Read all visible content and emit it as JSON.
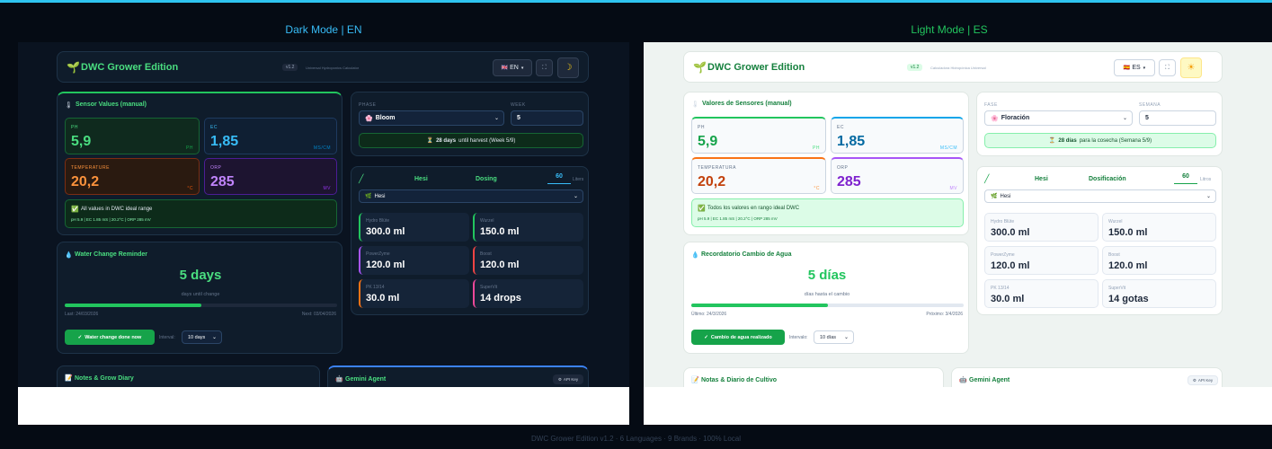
{
  "captions": {
    "dark": "Dark Mode  |  EN",
    "light": "Light Mode  |  ES"
  },
  "footer": "DWC Grower Edition v1.2  ·  6 Languages  ·  9 Brands  ·  100% Local",
  "colors": {
    "accent_green": "#22c55e",
    "accent_blue": "#38bdf8",
    "ph": "#22c55e",
    "ec": "#38bdf8",
    "temperature": "#f97316",
    "orp": "#a855f7"
  },
  "dark": {
    "header": {
      "brand": "DWC Grower Edition",
      "version": "v1.2",
      "tagline": "Universal Hydroponics Calculator",
      "language": "EN",
      "flag": "uk-flag-icon",
      "theme_icon": "moon-icon"
    },
    "sensors": {
      "title": "Sensor Values (manual)",
      "ph": {
        "label": "PH",
        "value": "5,9",
        "unit": "PH"
      },
      "ec": {
        "label": "EC",
        "value": "1,85",
        "unit": "MS/CM"
      },
      "temp": {
        "label": "TEMPERATURE",
        "value": "20,2",
        "unit": "°C"
      },
      "orp": {
        "label": "ORP",
        "value": "285",
        "unit": "MV"
      },
      "status": "All values in DWC ideal range",
      "status_detail": "pH 5.9 | EC 1.85 mS | 20.2°C | ORP 285 mV"
    },
    "phase": {
      "phase_label": "PHASE",
      "phase_value": "Bloom",
      "week_label": "WEEK",
      "week_value": "5",
      "harvest_strong": "28 days",
      "harvest_rest": "until harvest (Week 5/9)"
    },
    "dosing": {
      "brand": "Hesi",
      "title": "Dosing",
      "liters": "60",
      "liters_unit": "Liters",
      "select": "Hesi",
      "items": [
        {
          "name": "Hydro Blüte",
          "amount": "300.0 ml"
        },
        {
          "name": "Wurzel",
          "amount": "150.0 ml"
        },
        {
          "name": "PowerZyme",
          "amount": "120.0 ml"
        },
        {
          "name": "Boost",
          "amount": "120.0 ml"
        },
        {
          "name": "PK 13/14",
          "amount": "30.0 ml"
        },
        {
          "name": "SuperVit",
          "amount": "14 drops"
        }
      ]
    },
    "water": {
      "title": "Water Change Reminder",
      "days": "5 days",
      "caption": "days until change",
      "progress": 0.5,
      "last": "Last: 24/03/2026",
      "next": "Next: 03/04/2026",
      "button": "Water change done now",
      "interval_label": "Interval:",
      "interval_value": "10 days"
    },
    "notes": {
      "title": "Notes & Grow Diary"
    },
    "agent": {
      "title": "Gemini Agent",
      "api": "API Key"
    }
  },
  "light": {
    "header": {
      "brand": "DWC Grower Edition",
      "version": "v1.2",
      "tagline": "Calculadora Hidropónica Universal",
      "language": "ES",
      "flag": "spain-flag-icon",
      "theme_icon": "sun-icon"
    },
    "sensors": {
      "title": "Valores de Sensores (manual)",
      "ph": {
        "label": "PH",
        "value": "5,9",
        "unit": "PH"
      },
      "ec": {
        "label": "EC",
        "value": "1,85",
        "unit": "MS/CM"
      },
      "temp": {
        "label": "TEMPERATURA",
        "value": "20,2",
        "unit": "°C"
      },
      "orp": {
        "label": "ORP",
        "value": "285",
        "unit": "MV"
      },
      "status": "Todos los valores en rango ideal DWC",
      "status_detail": "pH 5.9 | EC 1.85 mS | 20.2°C | ORP 285 mV"
    },
    "phase": {
      "phase_label": "FASE",
      "phase_value": "Floración",
      "week_label": "SEMANA",
      "week_value": "5",
      "harvest_strong": "28 días",
      "harvest_rest": "para la cosecha (Semana 5/9)"
    },
    "dosing": {
      "brand": "Hesi",
      "title": "Dosificación",
      "liters": "60",
      "liters_unit": "Litros",
      "select": "Hesi",
      "items": [
        {
          "name": "Hydro Blüte",
          "amount": "300.0 ml"
        },
        {
          "name": "Wurzel",
          "amount": "150.0 ml"
        },
        {
          "name": "PowerZyme",
          "amount": "120.0 ml"
        },
        {
          "name": "Boost",
          "amount": "120.0 ml"
        },
        {
          "name": "PK 13/14",
          "amount": "30.0 ml"
        },
        {
          "name": "SuperVit",
          "amount": "14 gotas"
        }
      ]
    },
    "water": {
      "title": "Recordatorio Cambio de Agua",
      "days": "5 días",
      "caption": "días hasta el cambio",
      "progress": 0.5,
      "last": "Último: 24/3/2026",
      "next": "Próximo: 3/4/2026",
      "button": "Cambio de agua realizado",
      "interval_label": "Intervalo:",
      "interval_value": "10 días"
    },
    "notes": {
      "title": "Notas & Diario de Cultivo"
    },
    "agent": {
      "title": "Gemini Agent",
      "api": "API Key"
    }
  }
}
